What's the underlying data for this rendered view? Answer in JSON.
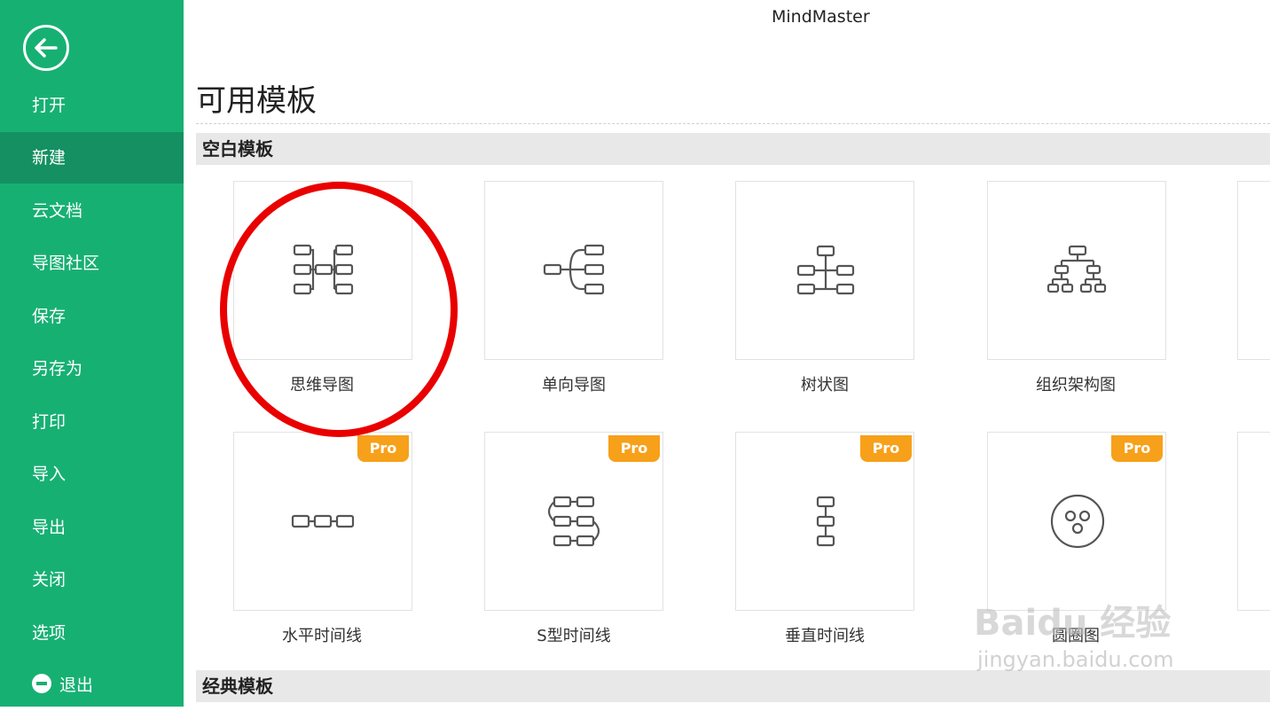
{
  "app": {
    "title": "MindMaster"
  },
  "sidebar": {
    "items": [
      {
        "id": "open",
        "label": "打开"
      },
      {
        "id": "new",
        "label": "新建"
      },
      {
        "id": "cloud-docs",
        "label": "云文档"
      },
      {
        "id": "community",
        "label": "导图社区"
      },
      {
        "id": "save",
        "label": "保存"
      },
      {
        "id": "save-as",
        "label": "另存为"
      },
      {
        "id": "print",
        "label": "打印"
      },
      {
        "id": "import",
        "label": "导入"
      },
      {
        "id": "export",
        "label": "导出"
      },
      {
        "id": "close",
        "label": "关闭"
      },
      {
        "id": "options",
        "label": "选项"
      },
      {
        "id": "exit",
        "label": "退出"
      }
    ],
    "active": "新建"
  },
  "main": {
    "title": "可用模板",
    "sections": [
      {
        "title": "空白模板",
        "templates": [
          {
            "label": "思维导图",
            "icon": "mind-map-icon",
            "pro": false
          },
          {
            "label": "单向导图",
            "icon": "right-map-icon",
            "pro": false
          },
          {
            "label": "树状图",
            "icon": "tree-map-icon",
            "pro": false
          },
          {
            "label": "组织架构图",
            "icon": "org-chart-icon",
            "pro": false
          },
          {
            "label": "水平时间线",
            "icon": "horizontal-timeline-icon",
            "pro": true,
            "badge": "Pro"
          },
          {
            "label": "S型时间线",
            "icon": "s-timeline-icon",
            "pro": true,
            "badge": "Pro"
          },
          {
            "label": "垂直时间线",
            "icon": "vertical-timeline-icon",
            "pro": true,
            "badge": "Pro"
          },
          {
            "label": "圆圈图",
            "icon": "circle-map-icon",
            "pro": true,
            "badge": "Pro"
          }
        ]
      },
      {
        "title": "经典模板"
      }
    ]
  },
  "watermark": {
    "brand": "Baidu 经验",
    "url": "jingyan.baidu.com"
  },
  "colors": {
    "sidebar": "#17b073",
    "active": "#149062",
    "pro": "#f7a01a",
    "highlight": "#e90000"
  }
}
